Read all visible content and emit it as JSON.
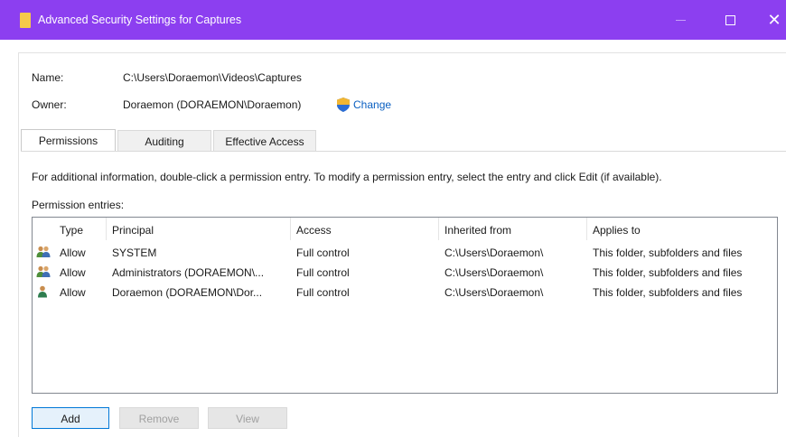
{
  "window": {
    "title": "Advanced Security Settings for Captures",
    "minimize_icon": "minimize-icon",
    "maximize_icon": "maximize-icon",
    "close_glyph": "✕"
  },
  "info": {
    "name_label": "Name:",
    "name_value": "C:\\Users\\Doraemon\\Videos\\Captures",
    "owner_label": "Owner:",
    "owner_value": "Doraemon (DORAEMON\\Doraemon)",
    "change_label": "Change"
  },
  "tabs": [
    {
      "label": "Permissions",
      "active": true
    },
    {
      "label": "Auditing",
      "active": false
    },
    {
      "label": "Effective Access",
      "active": false
    }
  ],
  "instructions": "For additional information, double-click a permission entry. To modify a permission entry, select the entry and click Edit (if available).",
  "entries_label": "Permission entries:",
  "columns": [
    "Type",
    "Principal",
    "Access",
    "Inherited from",
    "Applies to"
  ],
  "rows": [
    {
      "icon": "users-icon",
      "type": "Allow",
      "principal": "SYSTEM",
      "access": "Full control",
      "inherited": "C:\\Users\\Doraemon\\",
      "applies": "This folder, subfolders and files"
    },
    {
      "icon": "users-icon",
      "type": "Allow",
      "principal": "Administrators (DORAEMON\\...",
      "access": "Full control",
      "inherited": "C:\\Users\\Doraemon\\",
      "applies": "This folder, subfolders and files"
    },
    {
      "icon": "user-icon",
      "type": "Allow",
      "principal": "Doraemon (DORAEMON\\Dor...",
      "access": "Full control",
      "inherited": "C:\\Users\\Doraemon\\",
      "applies": "This folder, subfolders and files"
    }
  ],
  "buttons": {
    "add": "Add",
    "remove": "Remove",
    "view": "View"
  },
  "colors": {
    "titlebar": "#8c3ff0",
    "link": "#0a5fc1",
    "folder": "#f6c94a"
  }
}
